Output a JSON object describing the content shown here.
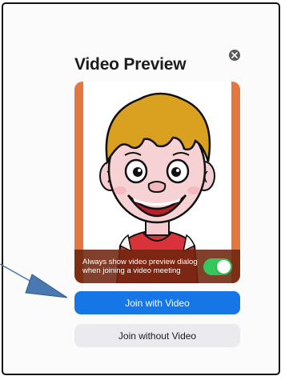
{
  "dialog": {
    "title": "Video Preview",
    "close_icon": "close-x-icon",
    "preview_image": "cartoon-boy-avatar",
    "overlay_text": "Always show video preview dialog when joining a video meeting",
    "toggle_on": true,
    "join_with_video": "Join with Video",
    "join_without_video": "Join without Video"
  },
  "colors": {
    "primary": "#1676e6",
    "toggle_on": "#34c759",
    "preview_frame": "#e2773f",
    "annotation_arrow": "#4a78b0"
  }
}
